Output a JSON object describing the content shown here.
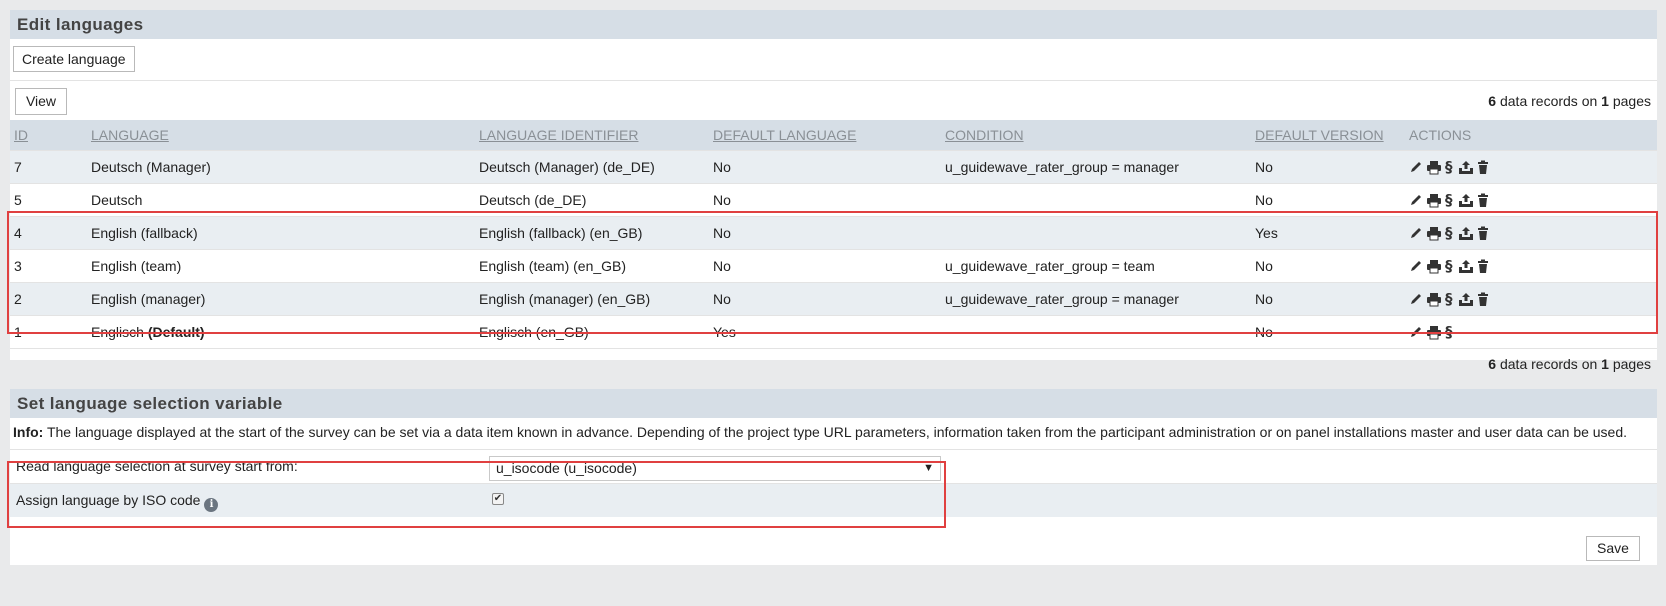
{
  "edit_languages": {
    "title": "Edit languages",
    "create_button": "Create language",
    "view_button": "View",
    "records": {
      "count": "6",
      "mid": " data records on ",
      "pages": "1",
      "suffix": " pages"
    },
    "columns": [
      "ID",
      "LANGUAGE",
      "LANGUAGE IDENTIFIER",
      "DEFAULT LANGUAGE",
      "CONDITION",
      "DEFAULT VERSION",
      "ACTIONS"
    ],
    "rows": [
      {
        "id": "7",
        "language": "Deutsch (Manager)",
        "language_bold": "",
        "identifier": "Deutsch (Manager) (de_DE)",
        "default_language": "No",
        "condition": "u_guidewave_rater_group = manager",
        "default_version": "No",
        "actions": [
          "edit-icon",
          "print-icon",
          "paragraph-icon",
          "export-icon",
          "delete-icon"
        ]
      },
      {
        "id": "5",
        "language": "Deutsch",
        "language_bold": "",
        "identifier": "Deutsch (de_DE)",
        "default_language": "No",
        "condition": "",
        "default_version": "No",
        "actions": [
          "edit-icon",
          "print-icon",
          "paragraph-icon",
          "export-icon",
          "delete-icon"
        ]
      },
      {
        "id": "4",
        "language": "English (fallback)",
        "language_bold": "",
        "identifier": "English (fallback) (en_GB)",
        "default_language": "No",
        "condition": "",
        "default_version": "Yes",
        "actions": [
          "edit-icon",
          "print-icon",
          "paragraph-icon",
          "export-icon",
          "delete-icon"
        ]
      },
      {
        "id": "3",
        "language": "English (team)",
        "language_bold": "",
        "identifier": "English (team) (en_GB)",
        "default_language": "No",
        "condition": "u_guidewave_rater_group = team",
        "default_version": "No",
        "actions": [
          "edit-icon",
          "print-icon",
          "paragraph-icon",
          "export-icon",
          "delete-icon"
        ]
      },
      {
        "id": "2",
        "language": "English (manager)",
        "language_bold": "",
        "identifier": "English (manager) (en_GB)",
        "default_language": "No",
        "condition": "u_guidewave_rater_group = manager",
        "default_version": "No",
        "actions": [
          "edit-icon",
          "print-icon",
          "paragraph-icon",
          "export-icon",
          "delete-icon"
        ]
      },
      {
        "id": "1",
        "language": "Englisch ",
        "language_bold": "(Default)",
        "identifier": "Englisch (en_GB)",
        "default_language": "Yes",
        "condition": "",
        "default_version": "No",
        "actions": [
          "edit-icon",
          "print-icon",
          "paragraph-icon"
        ]
      }
    ]
  },
  "selection_variable": {
    "title": "Set language selection variable",
    "info_label": "Info:",
    "info_text": " The language displayed at the start of the survey can be set via a data item known in advance. Depending of the project type URL parameters, information taken from the participant administration or on panel installations master and user data can be used.",
    "read_label": "Read language selection at survey start from:",
    "read_value": "u_isocode (u_isocode)",
    "assign_label": "Assign language by ISO code",
    "assign_checked": true,
    "save_button": "Save"
  },
  "colors": {
    "header_bg": "#d6dee6",
    "highlight": "#e04040",
    "row_alt": "#e9eef2"
  }
}
